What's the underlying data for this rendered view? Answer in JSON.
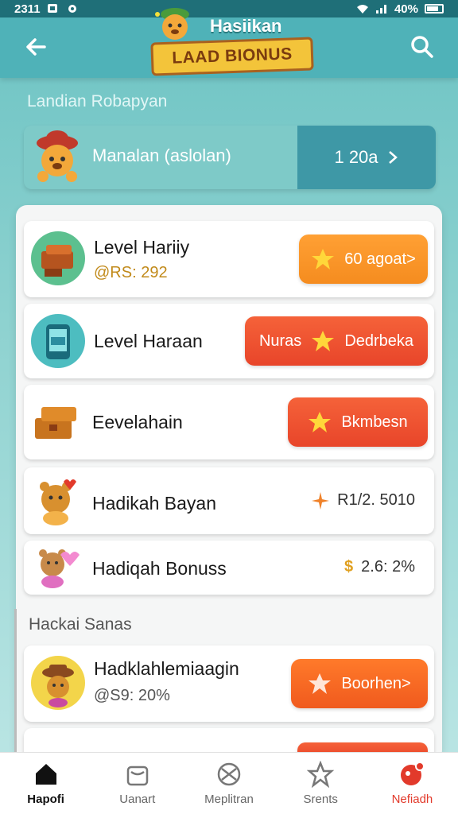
{
  "status_bar": {
    "time": "2311",
    "battery": "40%"
  },
  "header": {
    "logo_top": "Hasiikan",
    "logo_ribbon": "LAAD BIONUS"
  },
  "section_title": "Landian Robapyan",
  "main_bar": {
    "label": "Manalan (aslolan)",
    "value": "1 20a"
  },
  "cards": [
    {
      "title": "Level Hariiy",
      "sub": "@RS: 292",
      "button": "60 agoat>",
      "color": "#ffa034"
    },
    {
      "title": "Level Haraan",
      "button_left": "Nuras",
      "button": "Dedrbeka",
      "color": "#e8452a"
    },
    {
      "title": "Eevelahain",
      "button": "Bkmbesn",
      "color": "#e8452a"
    },
    {
      "title": "Hadikah Bayan",
      "value": "R1/2. 5010"
    },
    {
      "title": "Hadiqah Bonuss",
      "value": "2.6: 2%"
    }
  ],
  "section2_title": "Hackai Sanas",
  "card2": {
    "title": "Hadklahlemiaagin",
    "sub": "@S9: 20%",
    "button": "Boorhen>"
  },
  "nav": [
    {
      "label": "Hapofi",
      "icon": "home-icon"
    },
    {
      "label": "Uanart",
      "icon": "bag-icon"
    },
    {
      "label": "Meplitran",
      "icon": "globe-icon"
    },
    {
      "label": "Srents",
      "icon": "star-outline-icon"
    },
    {
      "label": "Nefiadh",
      "icon": "notification-icon"
    }
  ]
}
